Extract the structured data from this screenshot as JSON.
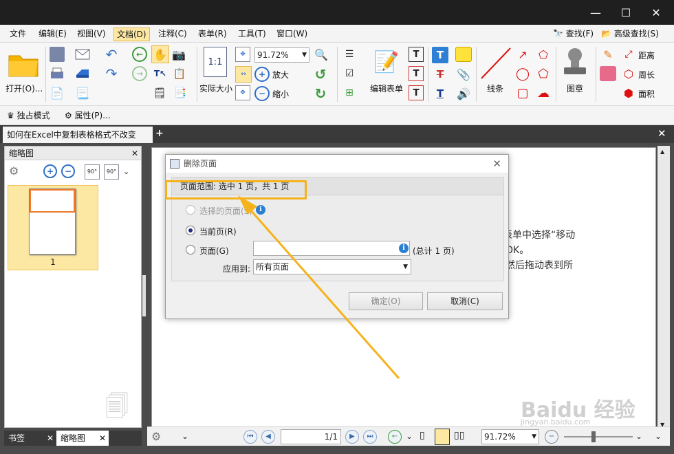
{
  "menu": [
    "文件",
    "编辑(E)",
    "视图(V)",
    "文档(D)",
    "注释(C)",
    "表单(R)",
    "工具(T)",
    "窗口(W)"
  ],
  "menu_right": {
    "find": "查找(F)",
    "advanced_find": "高级查找(S)"
  },
  "ribbon": {
    "open": "打开(O)...",
    "zoom_value": "91.72%",
    "actual_size": "实际大小",
    "zoom_in": "放大",
    "zoom_out": "缩小",
    "actual_size_icon_text": "1:1",
    "edit_form": "编辑表单",
    "line": "线条",
    "stamp": "图章",
    "distance": "距离",
    "perimeter": "周长",
    "area": "面积"
  },
  "subbar": {
    "exclusive_mode": "独占模式",
    "properties": "属性(P)..."
  },
  "doc_tab": "如何在Excel中复制表格格式不改变",
  "left_panel": {
    "title": "缩略图",
    "page_number": "1",
    "rotate_left": "90°",
    "rotate_right": "90°"
  },
  "left_tabs": [
    "书签",
    "缩略图"
  ],
  "dialog": {
    "title": "删除页面",
    "range_label": "页面范围: 选中 1 页，共 1 页",
    "selected_pages": "选择的页面(S)",
    "current_page": "当前页(R)",
    "pages": "页面(G)",
    "total": "(总计 1 页)",
    "apply_to_label": "应用到:",
    "apply_to_value": "所有页面",
    "ok": "确定(O)",
    "cancel": "取消(C)"
  },
  "page_text": [
    "表单中选择“移动",
    "OK。",
    "，然后拖动表到所"
  ],
  "bottom": {
    "page_indicator": "1/1",
    "zoom": "91.72%"
  },
  "watermark": "Baidu 经验",
  "watermark_url": "jingyan.baidu.com",
  "colors": {
    "accent": "#f5b21b",
    "selection": "#fde8a3",
    "titlebar": "#1f1f1f",
    "workspace": "#4b4b4b"
  }
}
